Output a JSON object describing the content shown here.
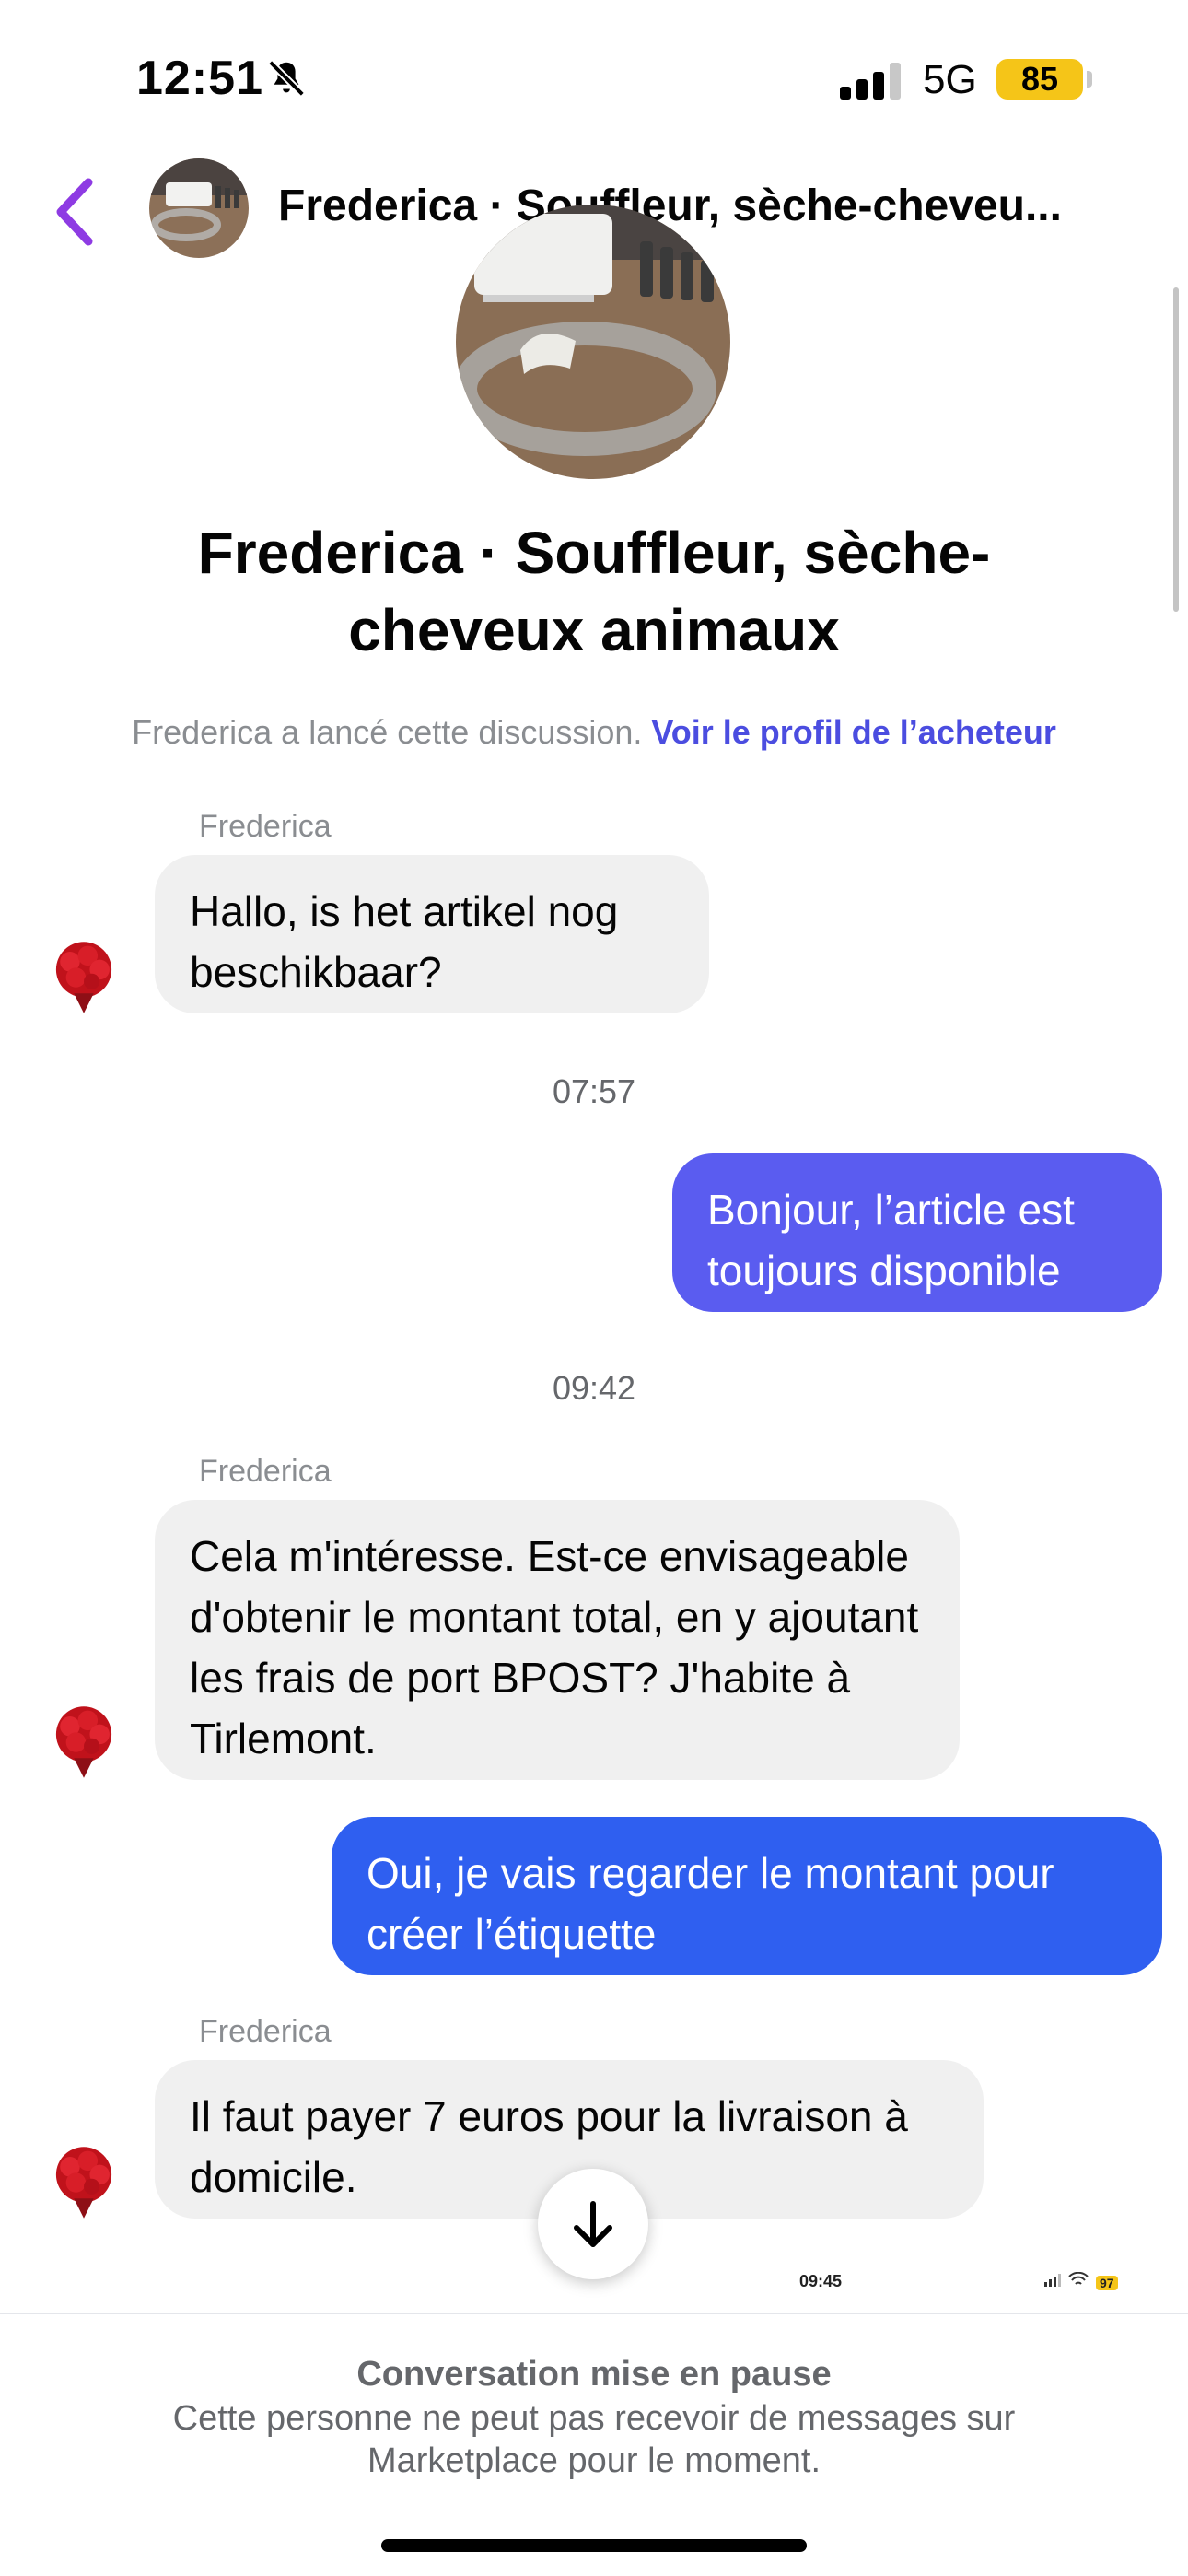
{
  "status_bar": {
    "time": "12:51",
    "network": "5G",
    "battery": "85"
  },
  "header": {
    "title": "Frederica · Souffleur, sèche-cheveu..."
  },
  "profile": {
    "name": "Frederica · Souffleur, sèche-cheveux animaux",
    "started_text": "Frederica a lancé cette discussion.",
    "buyer_link": "Voir le profil de l’acheteur"
  },
  "messages": [
    {
      "sender": "Frederica",
      "text": "Hallo, is het artikel nog beschikbaar?"
    },
    {
      "timestamp": "07:57"
    },
    {
      "text": "Bonjour, l’article est toujours disponible"
    },
    {
      "timestamp": "09:42"
    },
    {
      "sender": "Frederica",
      "text": "Cela m'intéresse. Est-ce envisageable d'obtenir le montant total, en y ajoutant les frais de port BPOST? J'habite  à Tirlemont."
    },
    {
      "text": "Oui, je vais regarder le montant pour créer l’étiquette"
    },
    {
      "sender": "Frederica",
      "text": "Il faut payer 7 euros pour la livraison à domicile."
    }
  ],
  "embedded_status": {
    "time": "09:45",
    "battery": "97"
  },
  "footer": {
    "title": "Conversation mise en pause",
    "subtitle": "Cette personne ne peut pas recevoir de messages sur Marketplace pour le moment."
  },
  "colors": {
    "accent": "#4b4de0",
    "out_bubble_1": "#5a5cf0",
    "out_bubble_2": "#2f5ff0",
    "back_chevron": "#8e3be3",
    "battery": "#f5c518"
  },
  "icons": {
    "back": "chevron-left-icon",
    "bell": "bell-slash-icon",
    "scroll": "arrow-down-icon"
  }
}
